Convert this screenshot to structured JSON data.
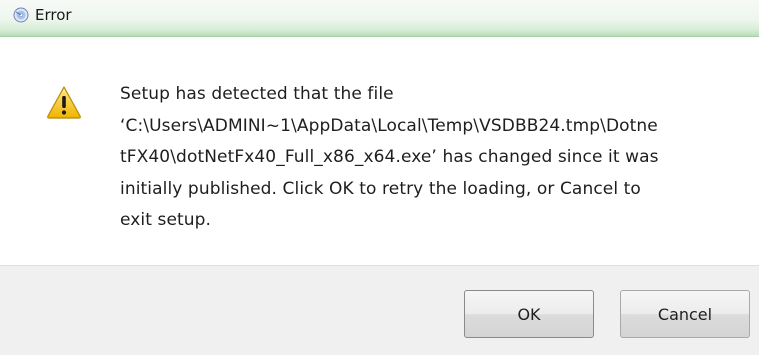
{
  "window": {
    "title": "Error",
    "icon": "setup-disc-icon"
  },
  "dialog": {
    "icon": "warning-icon",
    "message": "Setup has detected that the file\n‘C:\\Users\\ADMINI~1\\AppData\\Local\\Temp\\VSDBB24.tmp\\Dotne\ntFX40\\dotNetFx40_Full_x86_x64.exe’ has changed since it was\ninitially published. Click OK to retry the loading, or Cancel to\nexit setup."
  },
  "buttons": {
    "ok_label": "OK",
    "cancel_label": "Cancel"
  },
  "colors": {
    "titlebar_accent": "#b8dcb8",
    "footer_bg": "#f0f0f0",
    "warning_yellow": "#f5c518"
  }
}
